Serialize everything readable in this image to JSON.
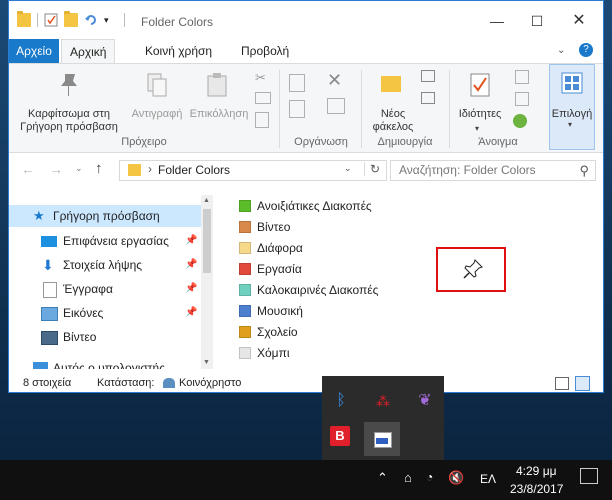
{
  "window": {
    "title": "Folder Colors"
  },
  "ribbon_tabs": [
    "Αρχείο",
    "Αρχική",
    "Κοινή χρήση",
    "Προβολή"
  ],
  "ribbon": {
    "pin_label": "Καρφίτσωμα στη Γρήγορη πρόσβαση",
    "copy_label": "Αντιγραφή",
    "paste_label": "Επικόλληση",
    "new_folder_label": "Νέος φάκελος",
    "properties_label": "Ιδιότητες",
    "select_label": "Επιλογή",
    "group_clipboard": "Πρόχειρο",
    "group_organize": "Οργάνωση",
    "group_new": "Δημιουργία",
    "group_open": "Άνοιγμα"
  },
  "address": {
    "path": "Folder Colors",
    "search_placeholder": "Αναζήτηση: Folder Colors"
  },
  "nav_items": [
    {
      "label": "Γρήγορη πρόσβαση"
    },
    {
      "label": "Επιφάνεια εργασίας"
    },
    {
      "label": "Στοιχεία λήψης"
    },
    {
      "label": "Έγγραφα"
    },
    {
      "label": "Εικόνες"
    },
    {
      "label": "Βίντεο"
    },
    {
      "label": "Αυτός ο υπολογιστής"
    }
  ],
  "files": [
    {
      "name": "Ανοιξιάτικες Διακοπές",
      "color": "#5cbd2a"
    },
    {
      "name": "Βίντεο",
      "color": "#d9894a"
    },
    {
      "name": "Διάφορα",
      "color": "#f7d98b"
    },
    {
      "name": "Εργασία",
      "color": "#e24b3b"
    },
    {
      "name": "Καλοκαιρινές Διακοπές",
      "color": "#6fd0c0"
    },
    {
      "name": "Μουσική",
      "color": "#4d7fd0"
    },
    {
      "name": "Σχολείο",
      "color": "#e0a01c"
    },
    {
      "name": "Χόμπι",
      "color": "#e6e6e6"
    }
  ],
  "status": {
    "count": "8 στοιχεία",
    "state_label": "Κατάσταση:",
    "state_value": "Κοινόχρηστο"
  },
  "taskbar": {
    "lang": "ΕΛ",
    "time": "4:29 μμ",
    "date": "23/8/2017"
  }
}
